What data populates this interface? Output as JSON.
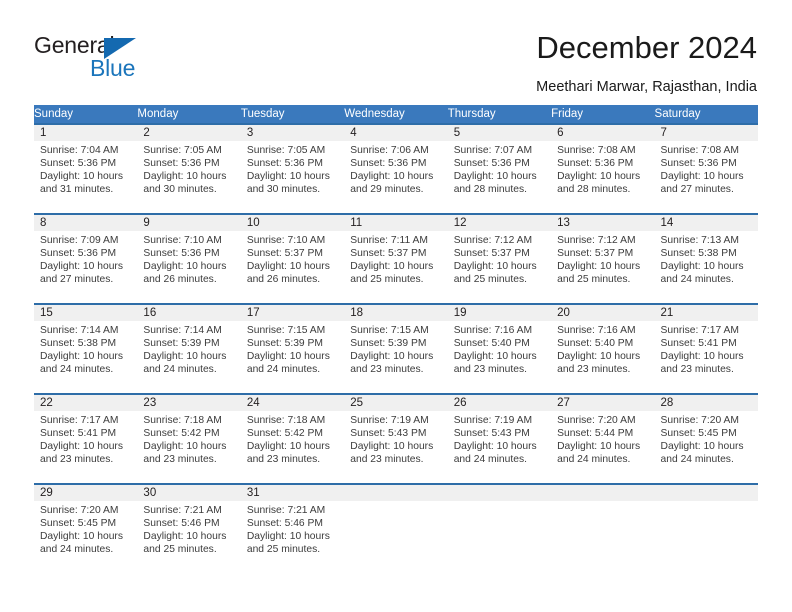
{
  "brand": {
    "line1": "General",
    "line2": "Blue",
    "mark": "triangle-logo-mark",
    "accent": "#1b75bb"
  },
  "header": {
    "title": "December 2024",
    "subtitle": "Meethari Marwar, Rajasthan, India"
  },
  "colors": {
    "header_blue": "#3a79bd",
    "row_rule_blue": "#2e6da8",
    "date_band_gray": "#f0f0f0",
    "text": "#3c3c3c"
  },
  "calendar": {
    "weekday_headers": [
      "Sunday",
      "Monday",
      "Tuesday",
      "Wednesday",
      "Thursday",
      "Friday",
      "Saturday"
    ],
    "weeks": [
      [
        {
          "day": "1",
          "sunrise": "Sunrise: 7:04 AM",
          "sunset": "Sunset: 5:36 PM",
          "daylight": "Daylight: 10 hours and 31 minutes."
        },
        {
          "day": "2",
          "sunrise": "Sunrise: 7:05 AM",
          "sunset": "Sunset: 5:36 PM",
          "daylight": "Daylight: 10 hours and 30 minutes."
        },
        {
          "day": "3",
          "sunrise": "Sunrise: 7:05 AM",
          "sunset": "Sunset: 5:36 PM",
          "daylight": "Daylight: 10 hours and 30 minutes."
        },
        {
          "day": "4",
          "sunrise": "Sunrise: 7:06 AM",
          "sunset": "Sunset: 5:36 PM",
          "daylight": "Daylight: 10 hours and 29 minutes."
        },
        {
          "day": "5",
          "sunrise": "Sunrise: 7:07 AM",
          "sunset": "Sunset: 5:36 PM",
          "daylight": "Daylight: 10 hours and 28 minutes."
        },
        {
          "day": "6",
          "sunrise": "Sunrise: 7:08 AM",
          "sunset": "Sunset: 5:36 PM",
          "daylight": "Daylight: 10 hours and 28 minutes."
        },
        {
          "day": "7",
          "sunrise": "Sunrise: 7:08 AM",
          "sunset": "Sunset: 5:36 PM",
          "daylight": "Daylight: 10 hours and 27 minutes."
        }
      ],
      [
        {
          "day": "8",
          "sunrise": "Sunrise: 7:09 AM",
          "sunset": "Sunset: 5:36 PM",
          "daylight": "Daylight: 10 hours and 27 minutes."
        },
        {
          "day": "9",
          "sunrise": "Sunrise: 7:10 AM",
          "sunset": "Sunset: 5:36 PM",
          "daylight": "Daylight: 10 hours and 26 minutes."
        },
        {
          "day": "10",
          "sunrise": "Sunrise: 7:10 AM",
          "sunset": "Sunset: 5:37 PM",
          "daylight": "Daylight: 10 hours and 26 minutes."
        },
        {
          "day": "11",
          "sunrise": "Sunrise: 7:11 AM",
          "sunset": "Sunset: 5:37 PM",
          "daylight": "Daylight: 10 hours and 25 minutes."
        },
        {
          "day": "12",
          "sunrise": "Sunrise: 7:12 AM",
          "sunset": "Sunset: 5:37 PM",
          "daylight": "Daylight: 10 hours and 25 minutes."
        },
        {
          "day": "13",
          "sunrise": "Sunrise: 7:12 AM",
          "sunset": "Sunset: 5:37 PM",
          "daylight": "Daylight: 10 hours and 25 minutes."
        },
        {
          "day": "14",
          "sunrise": "Sunrise: 7:13 AM",
          "sunset": "Sunset: 5:38 PM",
          "daylight": "Daylight: 10 hours and 24 minutes."
        }
      ],
      [
        {
          "day": "15",
          "sunrise": "Sunrise: 7:14 AM",
          "sunset": "Sunset: 5:38 PM",
          "daylight": "Daylight: 10 hours and 24 minutes."
        },
        {
          "day": "16",
          "sunrise": "Sunrise: 7:14 AM",
          "sunset": "Sunset: 5:39 PM",
          "daylight": "Daylight: 10 hours and 24 minutes."
        },
        {
          "day": "17",
          "sunrise": "Sunrise: 7:15 AM",
          "sunset": "Sunset: 5:39 PM",
          "daylight": "Daylight: 10 hours and 24 minutes."
        },
        {
          "day": "18",
          "sunrise": "Sunrise: 7:15 AM",
          "sunset": "Sunset: 5:39 PM",
          "daylight": "Daylight: 10 hours and 23 minutes."
        },
        {
          "day": "19",
          "sunrise": "Sunrise: 7:16 AM",
          "sunset": "Sunset: 5:40 PM",
          "daylight": "Daylight: 10 hours and 23 minutes."
        },
        {
          "day": "20",
          "sunrise": "Sunrise: 7:16 AM",
          "sunset": "Sunset: 5:40 PM",
          "daylight": "Daylight: 10 hours and 23 minutes."
        },
        {
          "day": "21",
          "sunrise": "Sunrise: 7:17 AM",
          "sunset": "Sunset: 5:41 PM",
          "daylight": "Daylight: 10 hours and 23 minutes."
        }
      ],
      [
        {
          "day": "22",
          "sunrise": "Sunrise: 7:17 AM",
          "sunset": "Sunset: 5:41 PM",
          "daylight": "Daylight: 10 hours and 23 minutes."
        },
        {
          "day": "23",
          "sunrise": "Sunrise: 7:18 AM",
          "sunset": "Sunset: 5:42 PM",
          "daylight": "Daylight: 10 hours and 23 minutes."
        },
        {
          "day": "24",
          "sunrise": "Sunrise: 7:18 AM",
          "sunset": "Sunset: 5:42 PM",
          "daylight": "Daylight: 10 hours and 23 minutes."
        },
        {
          "day": "25",
          "sunrise": "Sunrise: 7:19 AM",
          "sunset": "Sunset: 5:43 PM",
          "daylight": "Daylight: 10 hours and 23 minutes."
        },
        {
          "day": "26",
          "sunrise": "Sunrise: 7:19 AM",
          "sunset": "Sunset: 5:43 PM",
          "daylight": "Daylight: 10 hours and 24 minutes."
        },
        {
          "day": "27",
          "sunrise": "Sunrise: 7:20 AM",
          "sunset": "Sunset: 5:44 PM",
          "daylight": "Daylight: 10 hours and 24 minutes."
        },
        {
          "day": "28",
          "sunrise": "Sunrise: 7:20 AM",
          "sunset": "Sunset: 5:45 PM",
          "daylight": "Daylight: 10 hours and 24 minutes."
        }
      ],
      [
        {
          "day": "29",
          "sunrise": "Sunrise: 7:20 AM",
          "sunset": "Sunset: 5:45 PM",
          "daylight": "Daylight: 10 hours and 24 minutes."
        },
        {
          "day": "30",
          "sunrise": "Sunrise: 7:21 AM",
          "sunset": "Sunset: 5:46 PM",
          "daylight": "Daylight: 10 hours and 25 minutes."
        },
        {
          "day": "31",
          "sunrise": "Sunrise: 7:21 AM",
          "sunset": "Sunset: 5:46 PM",
          "daylight": "Daylight: 10 hours and 25 minutes."
        },
        {
          "day": "",
          "sunrise": "",
          "sunset": "",
          "daylight": ""
        },
        {
          "day": "",
          "sunrise": "",
          "sunset": "",
          "daylight": ""
        },
        {
          "day": "",
          "sunrise": "",
          "sunset": "",
          "daylight": ""
        },
        {
          "day": "",
          "sunrise": "",
          "sunset": "",
          "daylight": ""
        }
      ]
    ]
  }
}
